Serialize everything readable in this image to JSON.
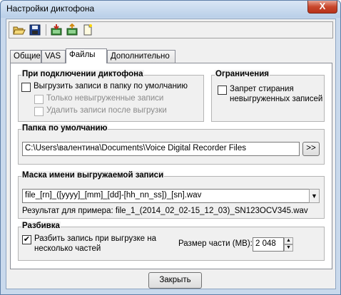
{
  "window": {
    "title": "Настройки диктофона",
    "close_symbol": "X"
  },
  "tabs": [
    {
      "label": "Общие"
    },
    {
      "label": "VAS"
    },
    {
      "label": "Файлы"
    },
    {
      "label": "Дополнительно"
    }
  ],
  "connection": {
    "legend": "При подключении диктофона",
    "upload_default": {
      "label": "Выгрузить записи в папку по умолчанию",
      "checked": false
    },
    "only_new": {
      "label": "Только невыгруженные записи",
      "checked": false
    },
    "delete_after": {
      "label": "Удалить записи после выгрузки",
      "checked": false
    }
  },
  "restrictions": {
    "legend": "Ограничения",
    "prevent_delete": {
      "label_line1": "Запрет стирания",
      "label_line2": "невыгруженных записей",
      "checked": false
    }
  },
  "default_folder": {
    "legend": "Папка по умолчанию",
    "path": "C:\\Users\\валентина\\Documents\\Voice Digital Recorder Files",
    "browse_label": ">>"
  },
  "mask": {
    "legend": "Маска имени выгружаемой записи",
    "value": "file_[rn]_([yyyy]_[mm]_[dd]-[hh_nn_ss])_[sn].wav",
    "example": "Результат для примера: file_1_(2014_02_02-15_12_03)_SN123OCV345.wav"
  },
  "split": {
    "legend": "Разбивка",
    "checkbox": {
      "label_line1": "Разбить запись при выгрузке на",
      "label_line2": "несколько частей",
      "checked": true
    },
    "size_label": "Размер части (MB):",
    "size_value": "2 048"
  },
  "close_button": "Закрыть"
}
